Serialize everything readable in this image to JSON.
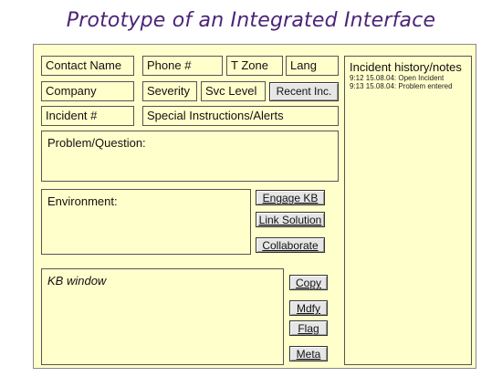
{
  "title": "Prototype of an Integrated Interface",
  "fields": {
    "contact_name": "Contact Name",
    "phone": "Phone #",
    "time_zone": "T Zone",
    "language": "Lang",
    "company": "Company",
    "severity": "Severity",
    "service_level": "Svc Level",
    "incident_number": "Incident #",
    "special_instructions": "Special Instructions/Alerts",
    "problem": "Problem/Question:",
    "environment": "Environment:",
    "kb_window": "KB window"
  },
  "buttons": {
    "recent_incidents": "Recent Inc.",
    "engage_kb": "Engage KB",
    "link_solution": "Link Solution",
    "collaborate": "Collaborate",
    "copy": "Copy",
    "modify": "Mdfy",
    "flag": "Flag",
    "meta": "Meta"
  },
  "notes": {
    "title": "Incident history/notes",
    "entries": [
      "9:12 15.08.04: Open Incident",
      "9:13 15.08.04: Problem entered"
    ]
  },
  "colors": {
    "panel_background": "#ffffcc",
    "title": "#4b2477"
  }
}
